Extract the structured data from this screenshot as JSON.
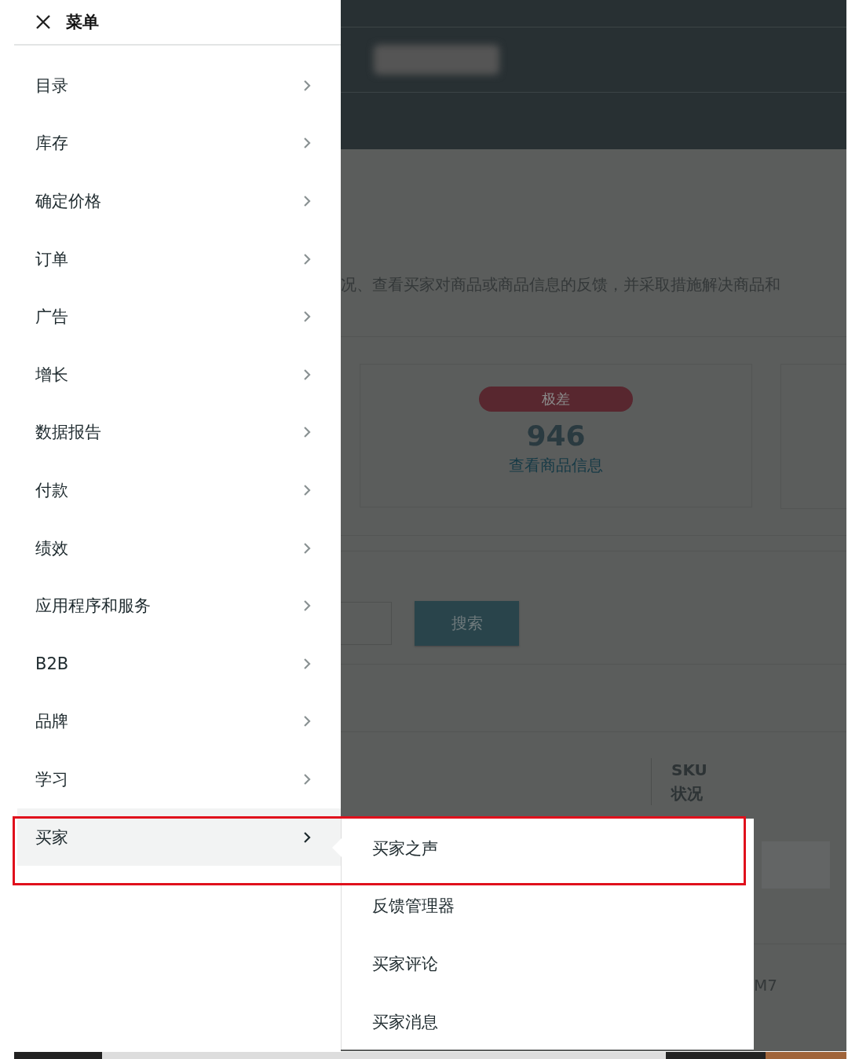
{
  "menu": {
    "title": "菜单",
    "items": [
      {
        "label": "目录",
        "selected": false
      },
      {
        "label": "库存",
        "selected": false
      },
      {
        "label": "确定价格",
        "selected": false
      },
      {
        "label": "订单",
        "selected": false
      },
      {
        "label": "广告",
        "selected": false
      },
      {
        "label": "增长",
        "selected": false
      },
      {
        "label": "数据报告",
        "selected": false
      },
      {
        "label": "付款",
        "selected": false
      },
      {
        "label": "绩效",
        "selected": false
      },
      {
        "label": "应用程序和服务",
        "selected": false
      },
      {
        "label": "B2B",
        "selected": false
      },
      {
        "label": "品牌",
        "selected": false
      },
      {
        "label": "学习",
        "selected": false
      },
      {
        "label": "买家",
        "selected": true
      }
    ]
  },
  "submenu": {
    "items": [
      {
        "label": "买家之声"
      },
      {
        "label": "反馈管理器"
      },
      {
        "label": "买家评论"
      },
      {
        "label": "买家消息"
      }
    ]
  },
  "annotation": {
    "kind": "frame"
  },
  "background_page": {
    "description": "况、查看买家对商品或商品信息的反馈，并采取措施解决商品和",
    "card": {
      "badge": "极差",
      "value": "946",
      "link": "查看商品信息"
    },
    "search_button": "搜索",
    "table": {
      "column_header": "SKU\n状况",
      "cell": "M7"
    }
  }
}
